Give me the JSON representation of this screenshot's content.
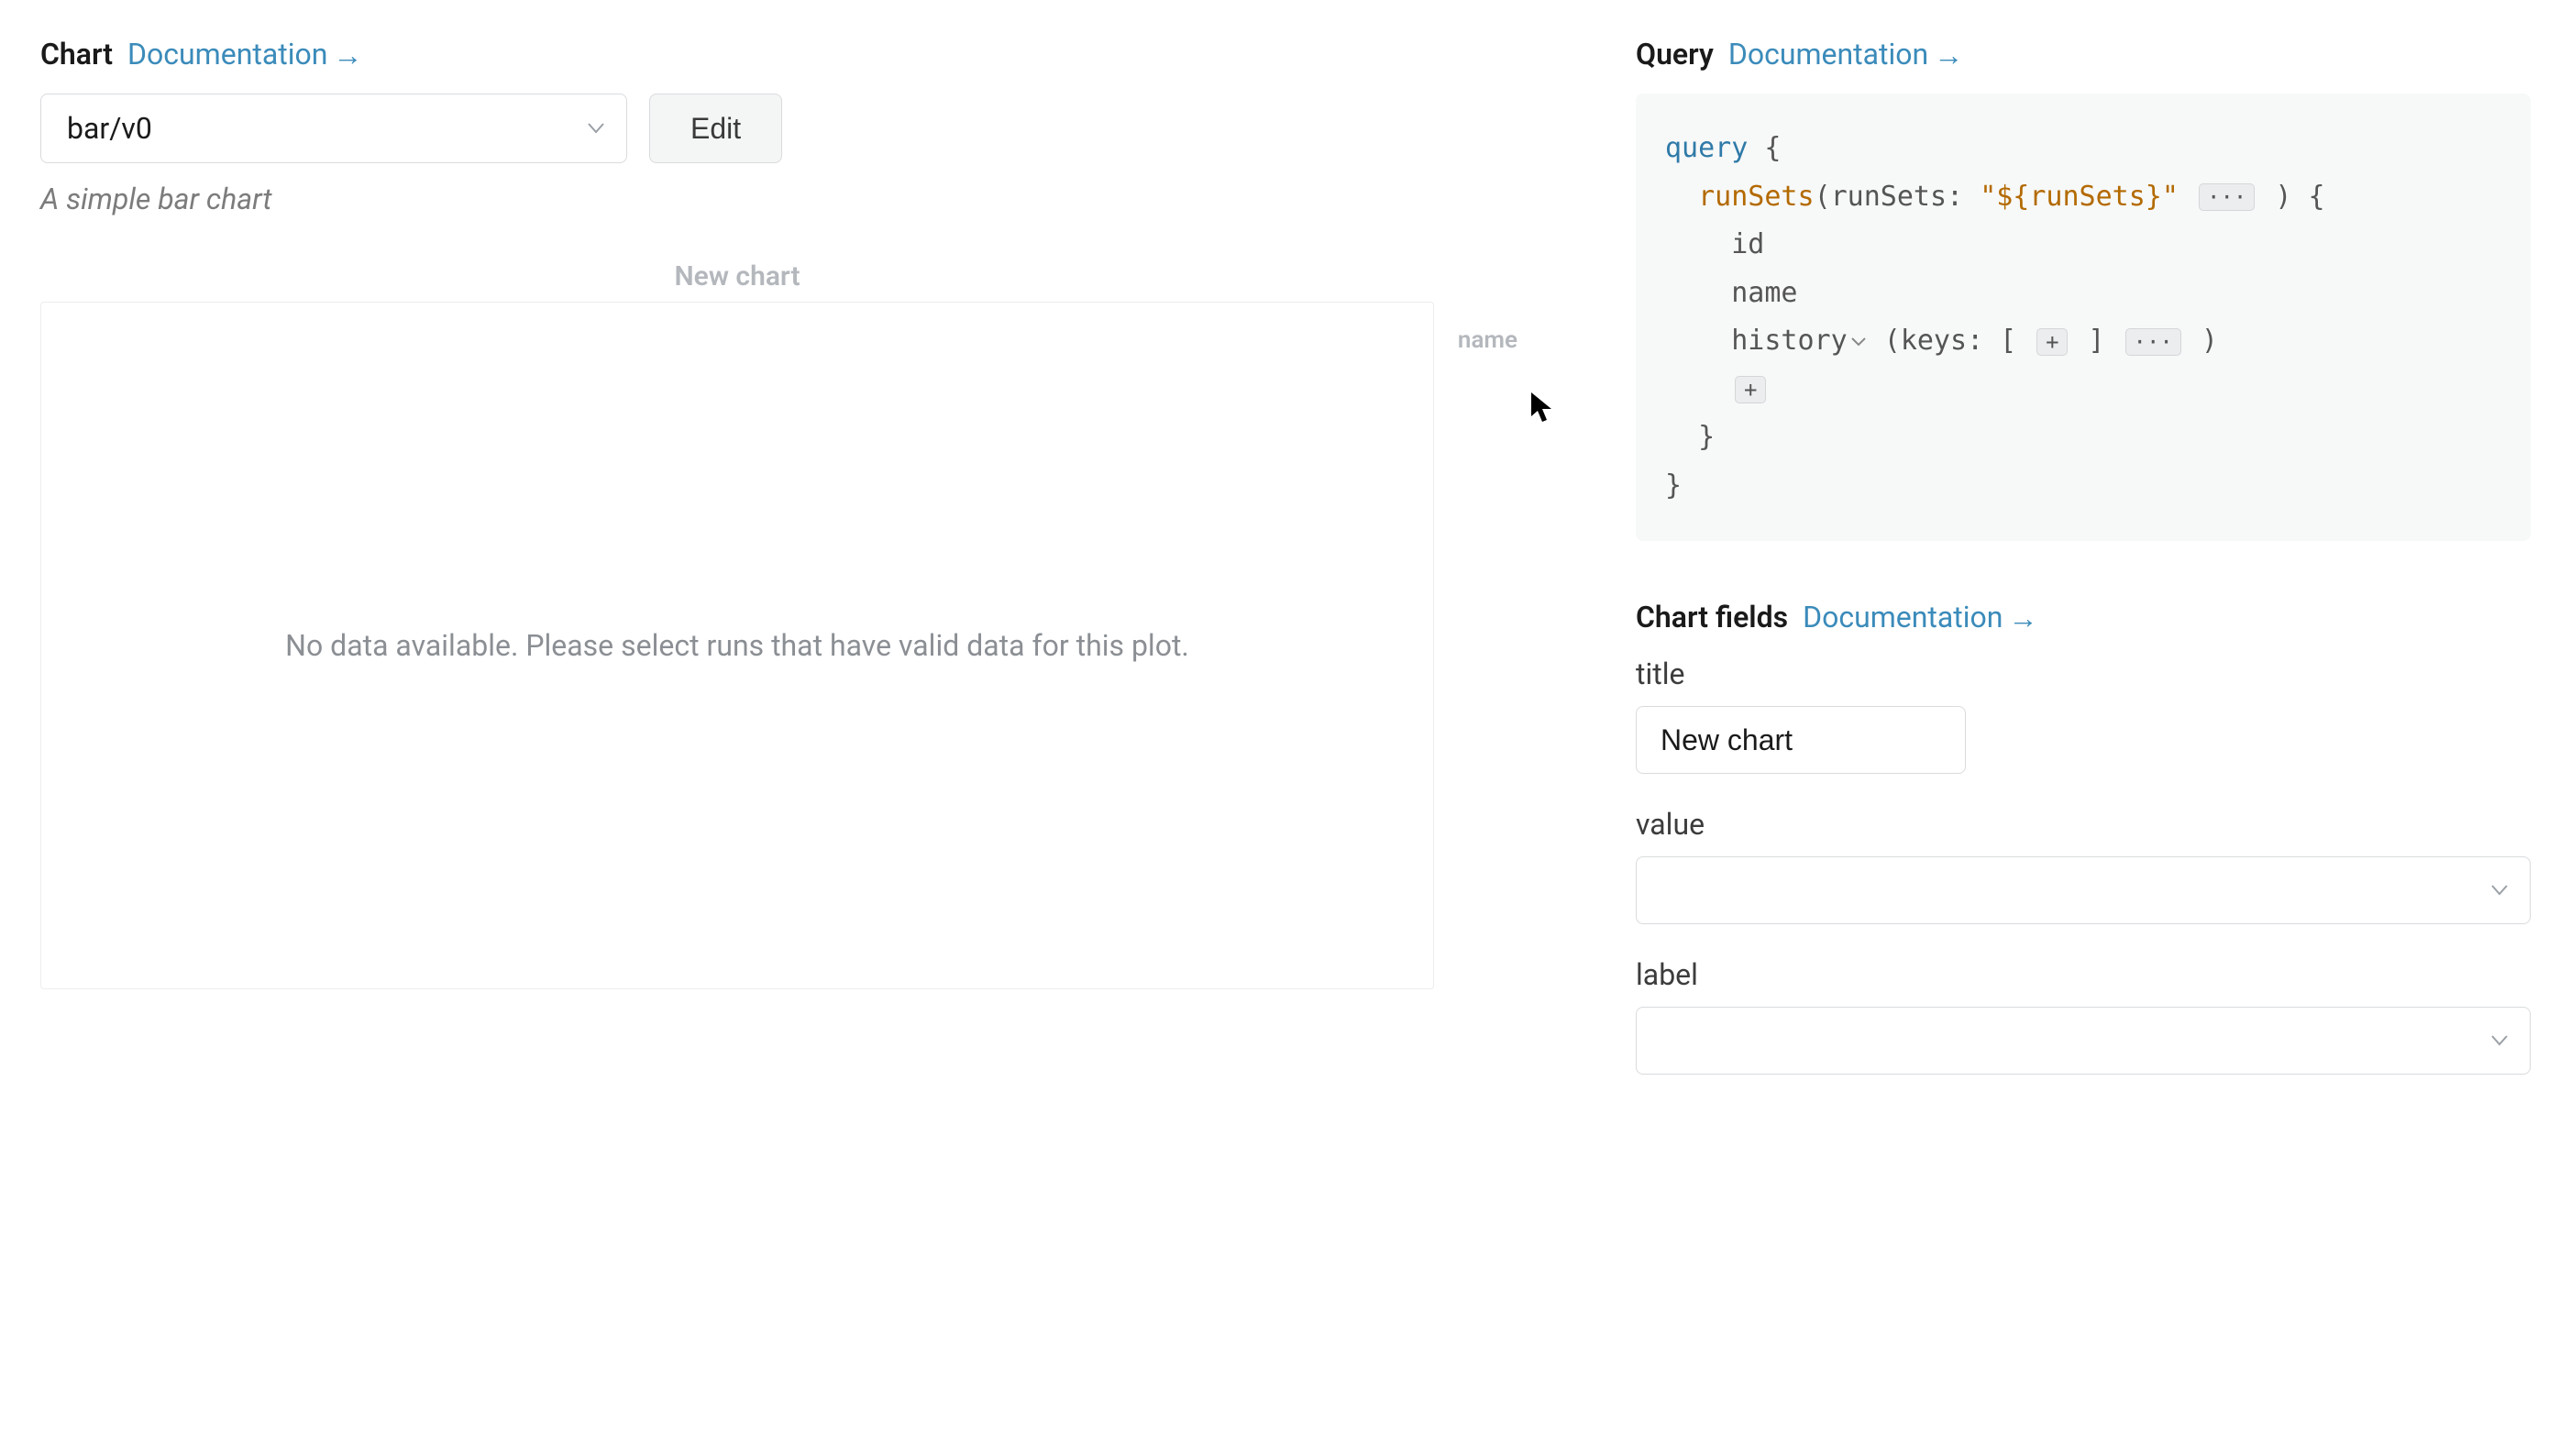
{
  "left": {
    "header_title": "Chart",
    "doc_link": "Documentation",
    "chart_type_selected": "bar/v0",
    "edit_button": "Edit",
    "description": "A simple bar chart",
    "preview_title": "New chart",
    "legend_label": "name",
    "no_data_message": "No data available. Please select runs that have valid data for this plot."
  },
  "right": {
    "query_header_title": "Query",
    "query_doc_link": "Documentation",
    "query": {
      "kw_query": "query",
      "open_brace": " {",
      "runSets_field": "runSets",
      "runSets_open": "(runSets: ",
      "runSets_value": "\"${runSets}\"",
      "ellipsis": "···",
      "runSets_close": " ) {",
      "id": "id",
      "name": "name",
      "history": "history",
      "history_args_open": " (",
      "history_keys_label": "keys",
      "history_keys_open": ": [ ",
      "plus": "+",
      "history_keys_close": " ] ",
      "history_args_close": " )",
      "close_inner": "}",
      "close_outer": "}"
    },
    "fields_header_title": "Chart fields",
    "fields_doc_link": "Documentation",
    "fields": {
      "title_label": "title",
      "title_value": "New chart",
      "value_label": "value",
      "value_value": "",
      "label_label": "label",
      "label_value": ""
    }
  }
}
